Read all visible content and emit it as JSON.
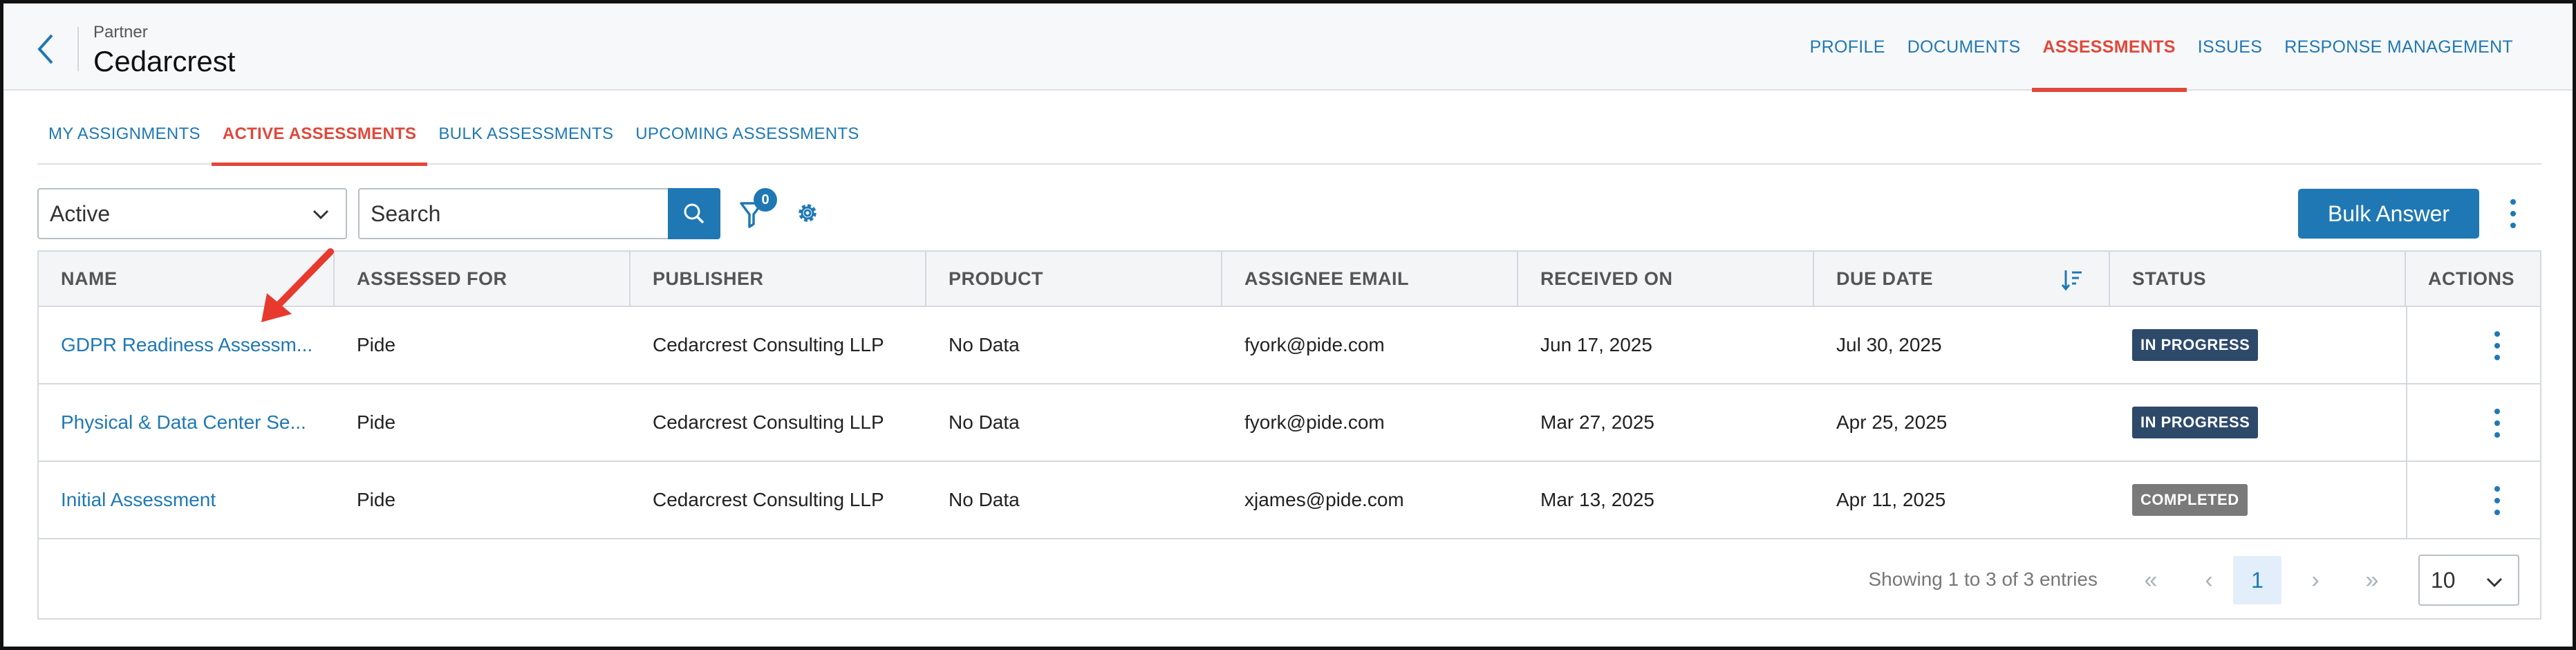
{
  "header": {
    "breadcrumb": "Partner",
    "title": "Cedarcrest",
    "tabs": [
      {
        "label": "PROFILE",
        "active": false
      },
      {
        "label": "DOCUMENTS",
        "active": false
      },
      {
        "label": "ASSESSMENTS",
        "active": true
      },
      {
        "label": "ISSUES",
        "active": false
      },
      {
        "label": "RESPONSE MANAGEMENT",
        "active": false
      }
    ]
  },
  "subtabs": [
    {
      "label": "MY ASSIGNMENTS",
      "active": false
    },
    {
      "label": "ACTIVE ASSESSMENTS",
      "active": true
    },
    {
      "label": "BULK ASSESSMENTS",
      "active": false
    },
    {
      "label": "UPCOMING ASSESSMENTS",
      "active": false
    }
  ],
  "toolbar": {
    "status_filter": "Active",
    "search_placeholder": "Search",
    "filter_count": "0",
    "bulk_answer_label": "Bulk Answer"
  },
  "table": {
    "columns": [
      "NAME",
      "ASSESSED FOR",
      "PUBLISHER",
      "PRODUCT",
      "ASSIGNEE EMAIL",
      "RECEIVED ON",
      "DUE DATE",
      "STATUS",
      "ACTIONS"
    ],
    "rows": [
      {
        "name": "GDPR Readiness Assessm...",
        "assessed_for": "Pide",
        "publisher": "Cedarcrest Consulting LLP",
        "product": "No Data",
        "assignee_email": "fyork@pide.com",
        "received_on": "Jun 17, 2025",
        "due_date": "Jul 30, 2025",
        "status": "IN PROGRESS"
      },
      {
        "name": "Physical & Data Center Se...",
        "assessed_for": "Pide",
        "publisher": "Cedarcrest Consulting LLP",
        "product": "No Data",
        "assignee_email": "fyork@pide.com",
        "received_on": "Mar 27, 2025",
        "due_date": "Apr 25, 2025",
        "status": "IN PROGRESS"
      },
      {
        "name": "Initial Assessment",
        "assessed_for": "Pide",
        "publisher": "Cedarcrest Consulting LLP",
        "product": "No Data",
        "assignee_email": "xjames@pide.com",
        "received_on": "Mar 13, 2025",
        "due_date": "Apr 11, 2025",
        "status": "COMPLETED"
      }
    ]
  },
  "pagination": {
    "entries_text": "Showing 1 to 3 of 3 entries",
    "first": "«",
    "prev": "‹",
    "current_page": "1",
    "next": "›",
    "last": "»",
    "page_size": "10"
  },
  "colors": {
    "accent": "#1f78b4",
    "active_tab": "#e0483a",
    "in_progress": "#2d4a6b",
    "completed": "#7a7a7a",
    "annotation_arrow": "#e8392f"
  }
}
